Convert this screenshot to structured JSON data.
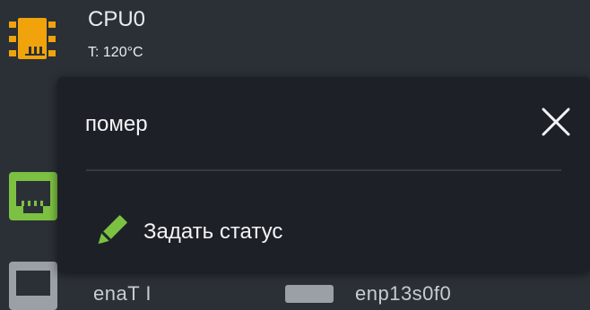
{
  "device_list": {
    "cpu": {
      "name": "CPU0",
      "temperature": "T: 120°C",
      "icon": "cpu-chip-icon",
      "status_color": "#f0a30a"
    },
    "items": [
      {
        "icon": "network-port-icon",
        "status_color": "#7cc142"
      },
      {
        "icon": "network-port-icon",
        "status_color": "#7cc142"
      }
    ],
    "bottom_row": {
      "label_1": "enaT I",
      "label_2": "enp13s0f0",
      "icon": "network-port-icon",
      "status_color": "#9aa0a6"
    }
  },
  "popup": {
    "title": "помер",
    "close_icon": "close-icon",
    "menu": [
      {
        "label": "Задать статус",
        "icon": "pencil-icon",
        "icon_color": "#7cc142"
      }
    ]
  }
}
